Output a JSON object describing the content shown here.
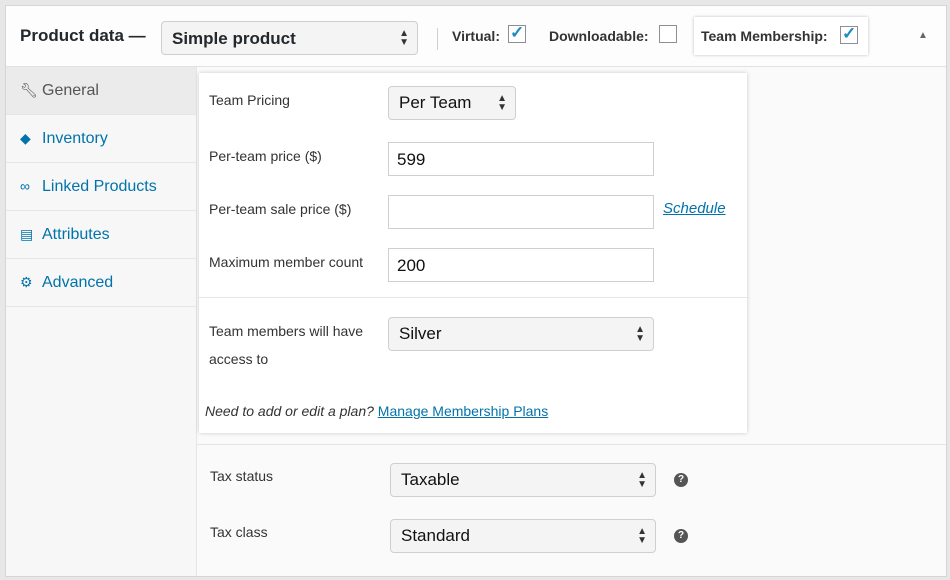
{
  "header": {
    "title": "Product data —",
    "product_type": "Simple product",
    "virtual_label": "Virtual:",
    "virtual_checked": true,
    "downloadable_label": "Downloadable:",
    "downloadable_checked": false,
    "team_membership_label": "Team Membership:",
    "team_membership_checked": true
  },
  "sidebar": {
    "items": [
      {
        "label": "General",
        "icon": "wrench-icon",
        "active": true
      },
      {
        "label": "Inventory",
        "icon": "tag-icon"
      },
      {
        "label": "Linked Products",
        "icon": "link-icon"
      },
      {
        "label": "Attributes",
        "icon": "list-icon"
      },
      {
        "label": "Advanced",
        "icon": "gear-icon"
      }
    ]
  },
  "popup": {
    "team_pricing_label": "Team Pricing",
    "team_pricing_value": "Per Team",
    "per_team_price_label": "Per-team price ($)",
    "per_team_price_value": "599",
    "per_team_sale_label": "Per-team sale price ($)",
    "per_team_sale_value": "",
    "schedule_link": "Schedule",
    "max_member_label": "Maximum member count",
    "max_member_value": "200",
    "access_label_line1": "Team members will have",
    "access_label_line2": "access to",
    "access_value": "Silver",
    "note_text": "Need to add or edit a plan?",
    "note_link": "Manage Membership Plans"
  },
  "tax": {
    "status_label": "Tax status",
    "status_value": "Taxable",
    "class_label": "Tax class",
    "class_value": "Standard"
  },
  "colors": {
    "link": "#0073aa",
    "checkbox_tick": "#1e8cbe"
  }
}
